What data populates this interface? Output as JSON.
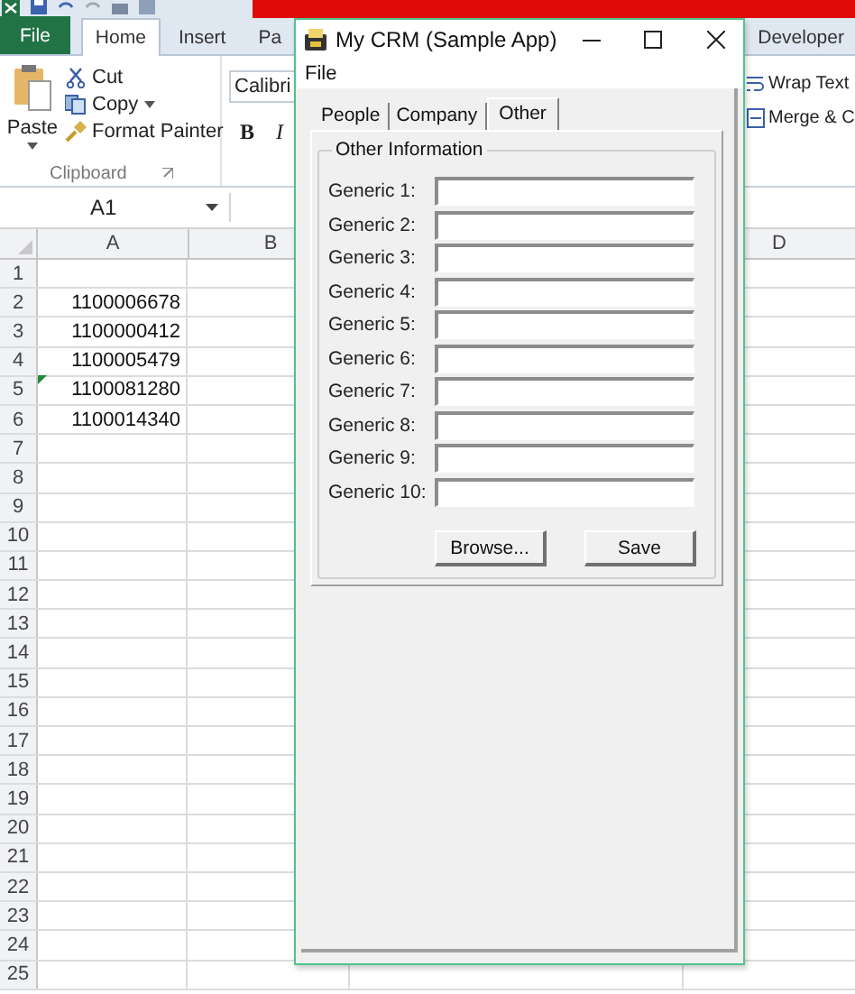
{
  "excel": {
    "ribbon_tabs": [
      {
        "label": "File",
        "kind": "file",
        "selected": false
      },
      {
        "label": "Home",
        "kind": "tab",
        "selected": true
      },
      {
        "label": "Insert",
        "kind": "tab",
        "selected": false
      },
      {
        "label": "Pa",
        "kind": "tab",
        "selected": false
      }
    ],
    "right_tabs": [
      {
        "label": "Developer",
        "selected": false
      }
    ],
    "clipboard": {
      "paste": "Paste",
      "cut": "Cut",
      "copy": "Copy",
      "format_painter": "Format Painter",
      "label": "Clipboard"
    },
    "font": {
      "name": "Calibri",
      "bold": "B",
      "italic": "I"
    },
    "alignment": {
      "wrap_text": "Wrap Text",
      "merge": "Merge & C"
    },
    "name_box": "A1",
    "columns": [
      "A",
      "B",
      "D"
    ],
    "rows": [
      {
        "header": "1"
      },
      {
        "header": "2",
        "value": "1100006678"
      },
      {
        "header": "3",
        "value": "1100000412"
      },
      {
        "header": "4",
        "value": "1100005479"
      },
      {
        "header": "5",
        "value": "1100081280",
        "flagged": true
      },
      {
        "header": "6",
        "value": "1100014340"
      },
      {
        "header": "7"
      },
      {
        "header": "8"
      },
      {
        "header": "9"
      },
      {
        "header": "10"
      },
      {
        "header": "11"
      },
      {
        "header": "12"
      },
      {
        "header": "13"
      },
      {
        "header": "14"
      },
      {
        "header": "15"
      },
      {
        "header": "16"
      },
      {
        "header": "17"
      },
      {
        "header": "18"
      },
      {
        "header": "19"
      },
      {
        "header": "20"
      },
      {
        "header": "21"
      },
      {
        "header": "22"
      },
      {
        "header": "23"
      },
      {
        "header": "24"
      },
      {
        "header": "25"
      }
    ]
  },
  "dialog": {
    "title": "My CRM (Sample App)",
    "menu": [
      "File"
    ],
    "tabs": [
      {
        "label": "People",
        "selected": false
      },
      {
        "label": "Company",
        "selected": false
      },
      {
        "label": "Other",
        "selected": true
      }
    ],
    "group_title": "Other Information",
    "fields": [
      {
        "label": "Generic 1:"
      },
      {
        "label": "Generic 2:"
      },
      {
        "label": "Generic 3:"
      },
      {
        "label": "Generic 4:"
      },
      {
        "label": "Generic 5:"
      },
      {
        "label": "Generic 6:"
      },
      {
        "label": "Generic 7:"
      },
      {
        "label": "Generic 8:"
      },
      {
        "label": "Generic 9:"
      },
      {
        "label": "Generic 10:"
      }
    ],
    "buttons": [
      "Browse...",
      "Save"
    ]
  }
}
